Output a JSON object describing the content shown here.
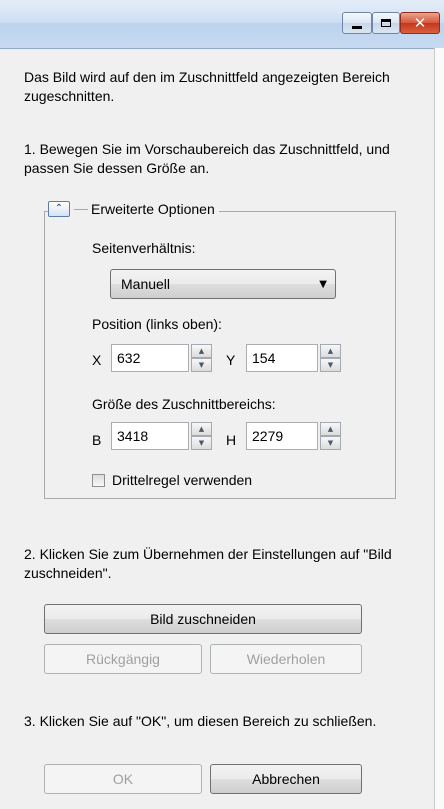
{
  "window": {
    "controls": {
      "minimize_icon": "minimize-icon",
      "maximize_icon": "maximize-icon",
      "close_glyph": "✕"
    }
  },
  "intro": "Das Bild wird auf den im Zuschnittfeld angezeigten Bereich zugeschnitten.",
  "step1": "1. Bewegen Sie im Vorschaubereich das Zuschnittfeld, und passen Sie dessen Größe an.",
  "advanced": {
    "collapse_glyph": "⌃",
    "title": "Erweiterte Optionen",
    "aspect_label": "Seitenverhältnis:",
    "aspect_value": "Manuell",
    "dropdown_arrow": "▼",
    "position_label": "Position (links oben):",
    "x_label": "X",
    "x_value": "632",
    "y_label": "Y",
    "y_value": "154",
    "size_label": "Größe des Zuschnittbereichs:",
    "w_label": "B",
    "w_value": "3418",
    "h_label": "H",
    "h_value": "2279",
    "spin_up": "▲",
    "spin_down": "▼",
    "thirds_label": "Drittelregel verwenden",
    "thirds_checked": false
  },
  "step2": "2. Klicken Sie zum Übernehmen der Einstellungen auf \"Bild zuschneiden\".",
  "buttons": {
    "crop": "Bild zuschneiden",
    "undo": "Rückgängig",
    "redo": "Wiederholen",
    "ok": "OK",
    "cancel": "Abbrechen"
  },
  "step3": "3. Klicken Sie auf \"OK\", um diesen Bereich zu schließen.",
  "colors": {
    "titlebar": "#c7daf1",
    "close_button": "#c5351c",
    "disabled_text": "#a0a0a0"
  }
}
